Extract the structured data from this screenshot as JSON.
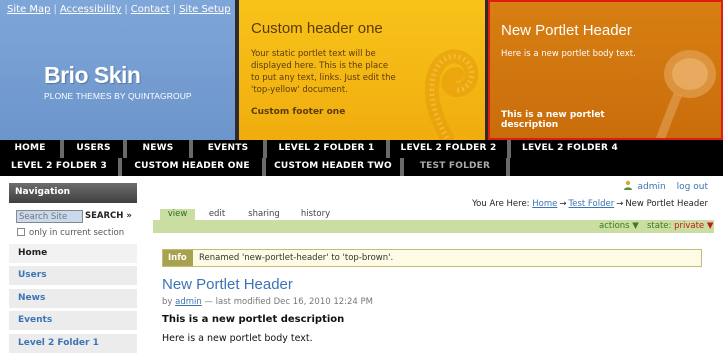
{
  "site_actions": [
    "Site Map",
    "Accessibility",
    "Contact",
    "Site Setup"
  ],
  "brand": {
    "title": "Brio Skin",
    "subtitle": "PLONE THEMES BY QUINTAGROUP"
  },
  "yellow_portlet": {
    "title": "Custom header one",
    "body": "Your static portlet  text will be displayed here.  This is the place to put any text, links.  Just edit the 'top-yellow' document.",
    "footer": "Custom footer one"
  },
  "brown_portlet": {
    "title": "New Portlet Header",
    "body": "Here is a new portlet body text.",
    "description": "This is a new portlet description"
  },
  "nav": [
    "HOME",
    "USERS",
    "NEWS",
    "EVENTS",
    "LEVEL 2 FOLDER 1",
    "LEVEL 2 FOLDER 2",
    "LEVEL 2 FOLDER 4",
    "LEVEL 2 FOLDER 3",
    "CUSTOM HEADER ONE",
    "CUSTOM HEADER TWO",
    "TEST FOLDER"
  ],
  "navigation": {
    "heading": "Navigation",
    "search_placeholder": "Search Site",
    "search_button": "SEARCH »",
    "only_current": "only in current section",
    "items": [
      "Home",
      "Users",
      "News",
      "Events",
      "Level 2 Folder 1"
    ]
  },
  "user": {
    "name": "admin",
    "logout": "log out"
  },
  "breadcrumb": {
    "label": "You Are Here:",
    "crumbs": [
      "Home",
      "Test Folder"
    ],
    "current": "New Portlet Header",
    "arrow": "→"
  },
  "tabs": [
    "view",
    "edit",
    "sharing",
    "history"
  ],
  "actions": {
    "actions_label": "actions ▼",
    "state_label": "state:",
    "state_value": "private ▼"
  },
  "info": {
    "label": "Info",
    "message": "Renamed 'new-portlet-header' to 'top-brown'."
  },
  "document": {
    "title": "New Portlet Header",
    "by": "by",
    "author": "admin",
    "modified": "— last modified Dec 16, 2010 12:24 PM",
    "description": "This is a new portlet description",
    "body": "Here is a new portlet body text."
  },
  "colors": {
    "brand_blue": "#7299d0",
    "yellow": "#f5b914",
    "brown": "#cd740e",
    "link": "#3c74b5",
    "tab_green": "#c9dea0",
    "state_red": "#c41a1a"
  }
}
